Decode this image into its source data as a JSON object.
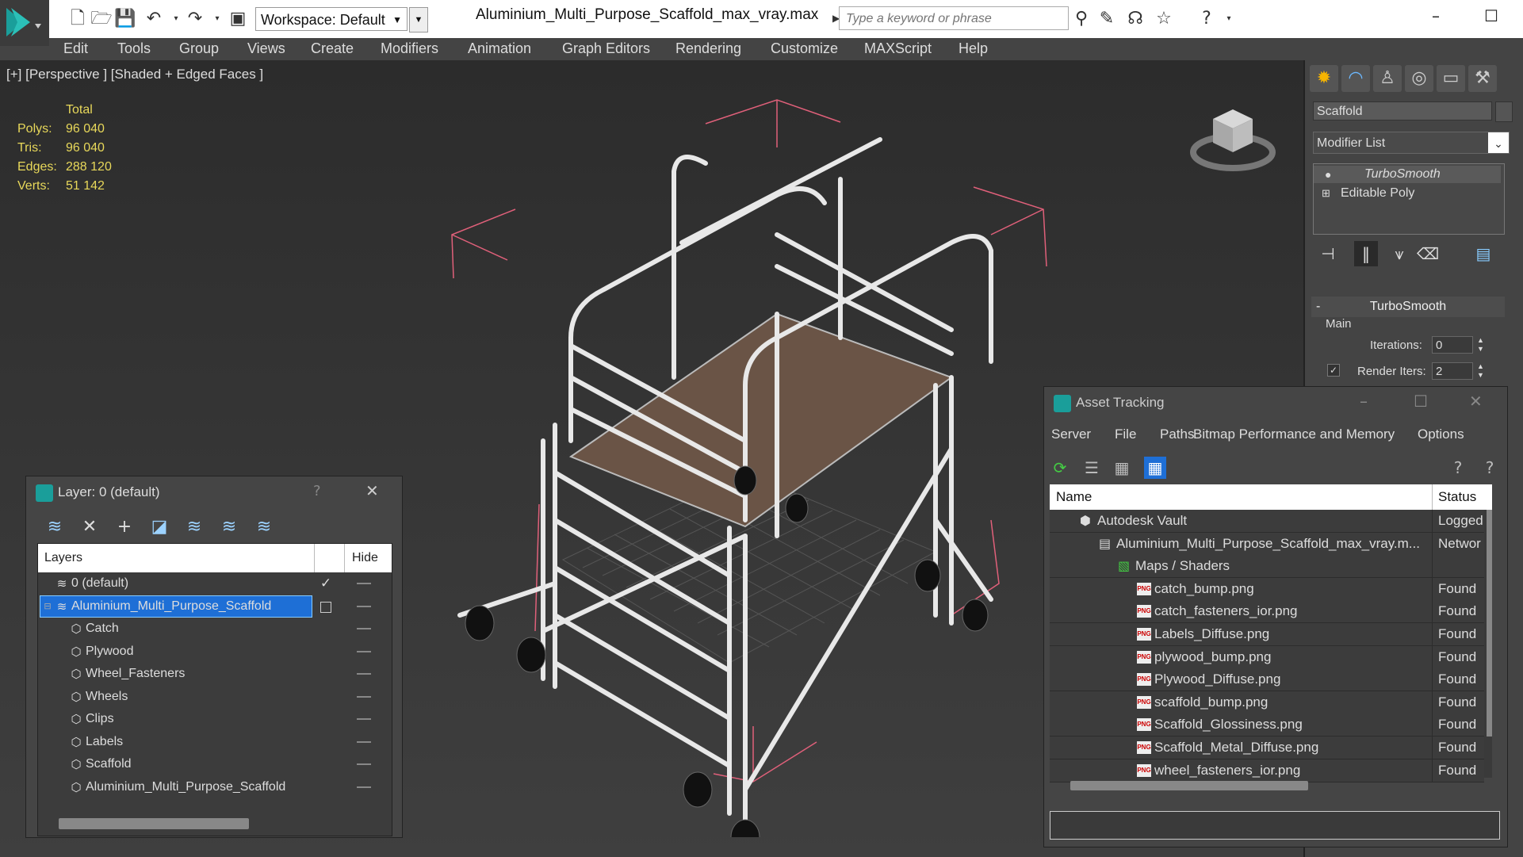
{
  "app": {
    "workspace": "Workspace: Default",
    "filename": "Aluminium_Multi_Purpose_Scaffold_max_vray.max",
    "search_placeholder": "Type a keyword or phrase"
  },
  "menu": [
    "Edit",
    "Tools",
    "Group",
    "Views",
    "Create",
    "Modifiers",
    "Animation",
    "Graph Editors",
    "Rendering",
    "Customize",
    "MAXScript",
    "Help"
  ],
  "viewport": {
    "label": "[+] [Perspective ] [Shaded + Edged Faces ]",
    "stats": {
      "header": "Total",
      "rows": [
        {
          "label": "Polys:",
          "value": "96 040"
        },
        {
          "label": "Tris:",
          "value": "96 040"
        },
        {
          "label": "Edges:",
          "value": "288 120"
        },
        {
          "label": "Verts:",
          "value": "51 142"
        }
      ]
    }
  },
  "command_panel": {
    "object_name": "Scaffold",
    "modifier_list": "Modifier List",
    "stack": [
      "TurboSmooth",
      "Editable Poly"
    ],
    "rollout": {
      "title": "TurboSmooth",
      "group": "Main",
      "iterations_label": "Iterations:",
      "iterations_value": "0",
      "render_iters_label": "Render Iters:",
      "render_iters_value": "2"
    }
  },
  "layer_dialog": {
    "title": "Layer: 0 (default)",
    "help": "?",
    "columns": {
      "layers": "Layers",
      "hide": "Hide"
    },
    "rows": [
      {
        "name": "0 (default)",
        "indent": 0,
        "active": true,
        "selected": false
      },
      {
        "name": "Aluminium_Multi_Purpose_Scaffold",
        "indent": 0,
        "active": false,
        "selected": true
      },
      {
        "name": "Catch",
        "indent": 1
      },
      {
        "name": "Plywood",
        "indent": 1
      },
      {
        "name": "Wheel_Fasteners",
        "indent": 1
      },
      {
        "name": "Wheels",
        "indent": 1
      },
      {
        "name": "Clips",
        "indent": 1
      },
      {
        "name": "Labels",
        "indent": 1
      },
      {
        "name": "Scaffold",
        "indent": 1
      },
      {
        "name": "Aluminium_Multi_Purpose_Scaffold",
        "indent": 1
      }
    ]
  },
  "asset_dialog": {
    "title": "Asset Tracking",
    "menu": [
      "Server",
      "File",
      "Paths",
      "Bitmap Performance and Memory",
      "Options"
    ],
    "columns": {
      "name": "Name",
      "status": "Status"
    },
    "rows": [
      {
        "name": "Autodesk Vault",
        "status": "Logged",
        "indent": 1,
        "icon": "vault-icon"
      },
      {
        "name": "Aluminium_Multi_Purpose_Scaffold_max_vray.m...",
        "status": "Networ",
        "indent": 2,
        "icon": "max-file-icon"
      },
      {
        "name": "Maps / Shaders",
        "status": "",
        "indent": 3,
        "icon": "maps-icon"
      },
      {
        "name": "catch_bump.png",
        "status": "Found",
        "indent": 4,
        "icon": "png-icon"
      },
      {
        "name": "catch_fasteners_ior.png",
        "status": "Found",
        "indent": 4,
        "icon": "png-icon"
      },
      {
        "name": "Labels_Diffuse.png",
        "status": "Found",
        "indent": 4,
        "icon": "png-icon"
      },
      {
        "name": "plywood_bump.png",
        "status": "Found",
        "indent": 4,
        "icon": "png-icon"
      },
      {
        "name": "Plywood_Diffuse.png",
        "status": "Found",
        "indent": 4,
        "icon": "png-icon"
      },
      {
        "name": "scaffold_bump.png",
        "status": "Found",
        "indent": 4,
        "icon": "png-icon"
      },
      {
        "name": "Scaffold_Glossiness.png",
        "status": "Found",
        "indent": 4,
        "icon": "png-icon"
      },
      {
        "name": "Scaffold_Metal_Diffuse.png",
        "status": "Found",
        "indent": 4,
        "icon": "png-icon"
      },
      {
        "name": "wheel_fasteners_ior.png",
        "status": "Found",
        "indent": 4,
        "icon": "png-icon"
      }
    ]
  },
  "colors": {
    "selection": "#1e6fd6",
    "stats": "#e8d85a",
    "bbox": "#e0607a"
  }
}
